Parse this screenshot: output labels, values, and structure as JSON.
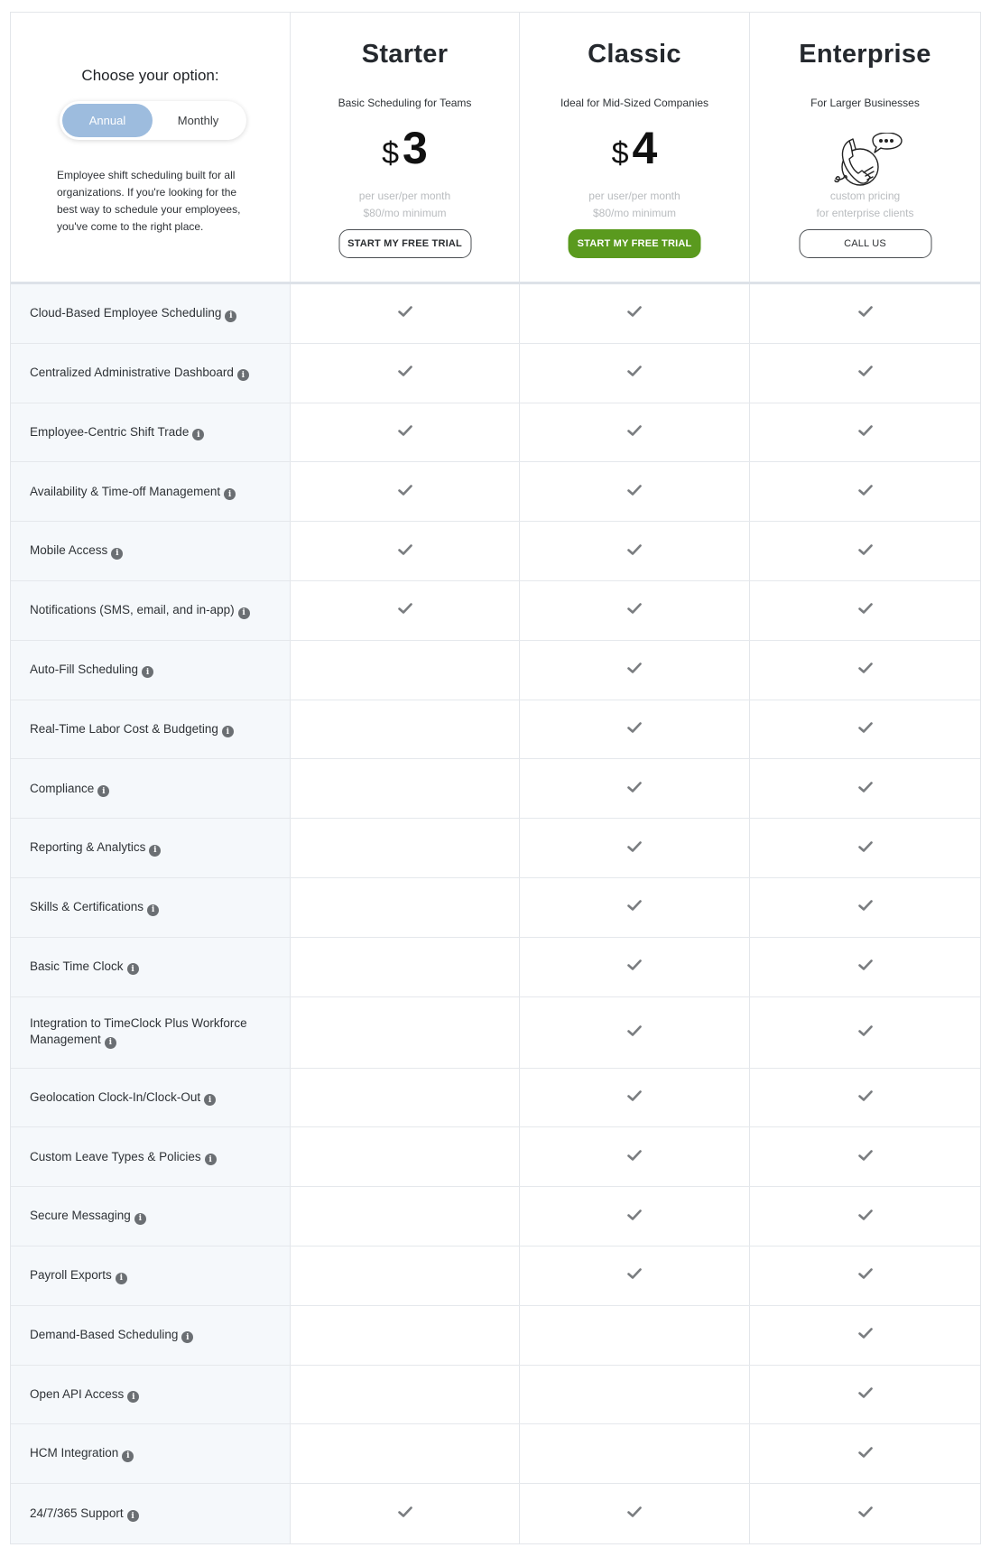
{
  "left_panel": {
    "title": "Choose your option:",
    "toggle": {
      "options": [
        "Annual",
        "Monthly"
      ],
      "selected": "Annual"
    },
    "description": "Employee shift scheduling built for all organizations. If you're looking for the best way to schedule your employees, you've come to the right place."
  },
  "plans": [
    {
      "name": "Starter",
      "subtitle": "Basic Scheduling for Teams",
      "currency": "$",
      "price": "3",
      "note_line1": "per user/per month",
      "note_line2": "$80/mo minimum",
      "cta": "START MY FREE TRIAL",
      "cta_style": "outline"
    },
    {
      "name": "Classic",
      "subtitle": "Ideal for Mid-Sized Companies",
      "currency": "$",
      "price": "4",
      "note_line1": "per user/per month",
      "note_line2": "$80/mo minimum",
      "cta": "START MY FREE TRIAL",
      "cta_style": "primary"
    },
    {
      "name": "Enterprise",
      "subtitle": "For Larger Businesses",
      "icon": "phone-chat-icon",
      "note_line1": "custom pricing",
      "note_line2": "for enterprise clients",
      "cta": "CALL US",
      "cta_style": "outline"
    }
  ],
  "colors": {
    "primary_green": "#5a9a1e",
    "toggle_active": "#9dbcde",
    "check": "#7a7d80",
    "feature_bg": "#f5f8fb"
  },
  "features": [
    {
      "label": "Cloud-Based Employee Scheduling",
      "starter": true,
      "classic": true,
      "enterprise": true
    },
    {
      "label": "Centralized Administrative Dashboard",
      "starter": true,
      "classic": true,
      "enterprise": true
    },
    {
      "label": "Employee-Centric Shift Trade",
      "starter": true,
      "classic": true,
      "enterprise": true
    },
    {
      "label": "Availability & Time-off Management",
      "starter": true,
      "classic": true,
      "enterprise": true
    },
    {
      "label": "Mobile Access",
      "starter": true,
      "classic": true,
      "enterprise": true
    },
    {
      "label": "Notifications (SMS, email, and in-app)",
      "starter": true,
      "classic": true,
      "enterprise": true
    },
    {
      "label": "Auto-Fill Scheduling",
      "starter": false,
      "classic": true,
      "enterprise": true
    },
    {
      "label": "Real-Time Labor Cost & Budgeting",
      "starter": false,
      "classic": true,
      "enterprise": true
    },
    {
      "label": "Compliance",
      "starter": false,
      "classic": true,
      "enterprise": true
    },
    {
      "label": "Reporting & Analytics",
      "starter": false,
      "classic": true,
      "enterprise": true
    },
    {
      "label": "Skills & Certifications",
      "starter": false,
      "classic": true,
      "enterprise": true
    },
    {
      "label": "Basic Time Clock",
      "starter": false,
      "classic": true,
      "enterprise": true
    },
    {
      "label": "Integration to TimeClock Plus Workforce Management",
      "starter": false,
      "classic": true,
      "enterprise": true,
      "tall": true
    },
    {
      "label": "Geolocation Clock-In/Clock-Out",
      "starter": false,
      "classic": true,
      "enterprise": true
    },
    {
      "label": "Custom Leave Types & Policies",
      "starter": false,
      "classic": true,
      "enterprise": true
    },
    {
      "label": "Secure Messaging",
      "starter": false,
      "classic": true,
      "enterprise": true
    },
    {
      "label": "Payroll Exports",
      "starter": false,
      "classic": true,
      "enterprise": true
    },
    {
      "label": "Demand-Based Scheduling",
      "starter": false,
      "classic": false,
      "enterprise": true
    },
    {
      "label": "Open API Access",
      "starter": false,
      "classic": false,
      "enterprise": true
    },
    {
      "label": "HCM Integration",
      "starter": false,
      "classic": false,
      "enterprise": true
    },
    {
      "label": "24/7/365 Support",
      "starter": true,
      "classic": true,
      "enterprise": true
    }
  ]
}
